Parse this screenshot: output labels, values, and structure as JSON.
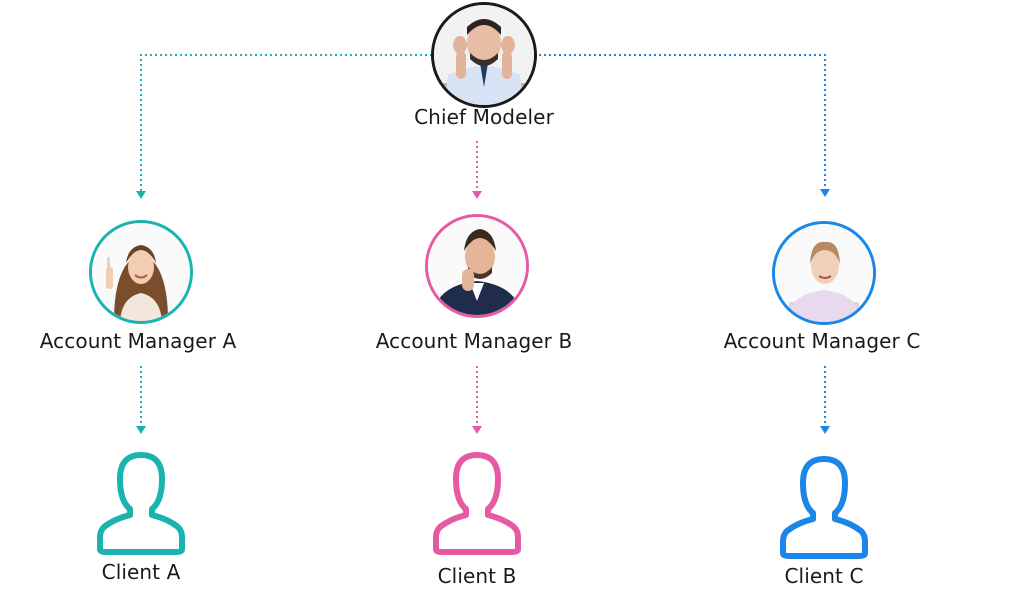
{
  "chief": {
    "label": "Chief Modeler",
    "icon": "chief-modeler-photo"
  },
  "managers": [
    {
      "label": "Account Manager A",
      "color": "#1ab3b0",
      "icon": "account-manager-a-photo"
    },
    {
      "label": "Account Manager B",
      "color": "#e65aa3",
      "icon": "account-manager-b-photo"
    },
    {
      "label": "Account Manager C",
      "color": "#1a86e8",
      "icon": "account-manager-c-photo"
    }
  ],
  "clients": [
    {
      "label": "Client A",
      "color": "#1ab3b0",
      "icon": "user-outline-icon"
    },
    {
      "label": "Client B",
      "color": "#e65aa3",
      "icon": "user-outline-icon"
    },
    {
      "label": "Client C",
      "color": "#1a86e8",
      "icon": "user-outline-icon"
    }
  ],
  "colors": {
    "chief_ring": "#1a1a1a",
    "text": "#1a1a1a"
  }
}
